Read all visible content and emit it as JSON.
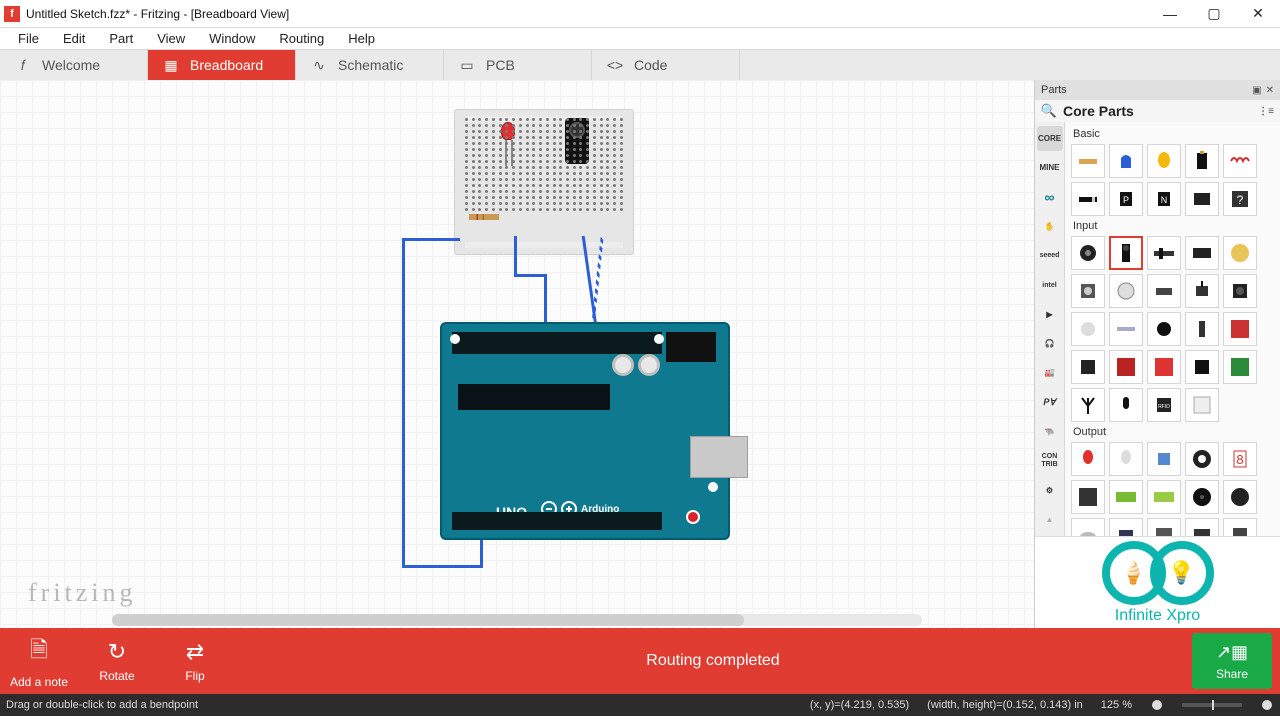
{
  "window": {
    "title": "Untitled Sketch.fzz* - Fritzing - [Breadboard View]",
    "icon_letter": "f"
  },
  "menu": [
    "File",
    "Edit",
    "Part",
    "View",
    "Window",
    "Routing",
    "Help"
  ],
  "view_tabs": {
    "welcome": "Welcome",
    "breadboard": "Breadboard",
    "schematic": "Schematic",
    "pcb": "PCB",
    "code": "Code"
  },
  "canvas": {
    "watermark": "fritzing",
    "arduino_label": "UNO",
    "arduino_brand": "Arduino"
  },
  "bottom": {
    "add_note": "Add a note",
    "rotate": "Rotate",
    "flip": "Flip",
    "routing_msg": "Routing completed",
    "share": "Share"
  },
  "status": {
    "hint": "Drag or double-click to add a bendpoint",
    "xy": "(x, y)=(4.219, 0.535)",
    "wh": "(width, height)=(0.152, 0.143) in",
    "zoom": "125 %"
  },
  "parts_panel": {
    "title": "Parts",
    "core_title": "Core Parts",
    "sections": {
      "basic": "Basic",
      "input": "Input",
      "output": "Output"
    },
    "bins": [
      "CORE",
      "MINE",
      "",
      "",
      "",
      "",
      "",
      "",
      "",
      "",
      "",
      "",
      "CON TRIB",
      ""
    ],
    "bin_icons": [
      "text",
      "text",
      "arduino",
      "hand",
      "seeed",
      "intel",
      "play",
      "headphones",
      "factory",
      "pa",
      "bull",
      "text",
      "gear"
    ]
  },
  "logo": {
    "text": "Infinite Xpro"
  }
}
